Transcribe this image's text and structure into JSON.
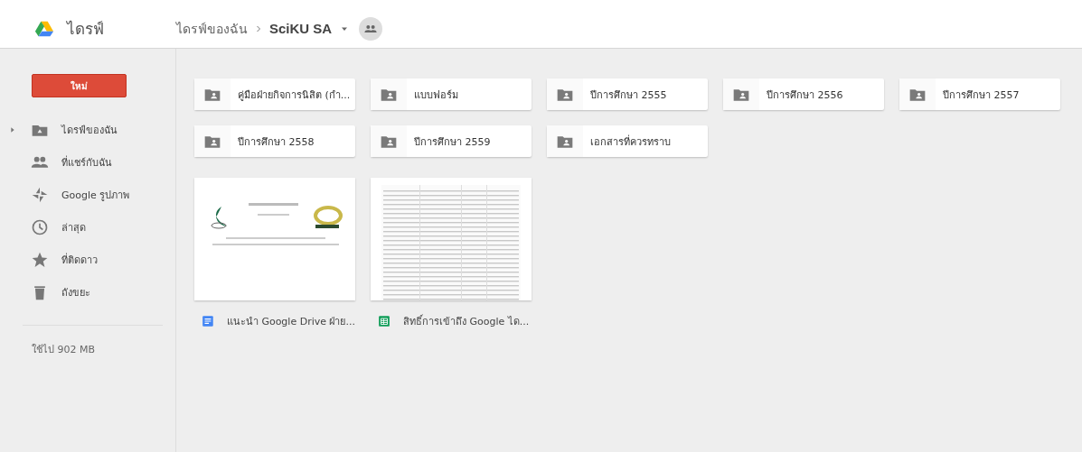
{
  "header": {
    "app_title": "ไดรฟ์",
    "breadcrumb": [
      {
        "label": "ไดรฟ์ของฉัน",
        "current": false
      },
      {
        "label": "SciKU SA",
        "current": true
      }
    ]
  },
  "sidebar": {
    "new_button": "ใหม่",
    "items": [
      {
        "kind": "mydrive",
        "label": "ไดรฟ์ของฉัน",
        "expandable": true
      },
      {
        "kind": "shared",
        "label": "ที่แชร์กับฉัน",
        "expandable": false
      },
      {
        "kind": "photos",
        "label": "Google รูปภาพ",
        "expandable": false
      },
      {
        "kind": "recent",
        "label": "ล่าสุด",
        "expandable": false
      },
      {
        "kind": "starred",
        "label": "ที่ติดดาว",
        "expandable": false
      },
      {
        "kind": "trash",
        "label": "ถังขยะ",
        "expandable": false
      }
    ],
    "storage": "ใช้ไป 902 MB"
  },
  "folders": [
    {
      "name": "คู่มือฝ่ายกิจการนิสิต (กำ..."
    },
    {
      "name": "แบบฟอร์ม"
    },
    {
      "name": "ปีการศึกษา 2555"
    },
    {
      "name": "ปีการศึกษา 2556"
    },
    {
      "name": "ปีการศึกษา 2557"
    },
    {
      "name": "ปีการศึกษา 2558"
    },
    {
      "name": "ปีการศึกษา 2559"
    },
    {
      "name": "เอกสารที่ควรทราบ"
    }
  ],
  "files": [
    {
      "kind": "doc",
      "name": "แนะนำ Google Drive ฝ่าย..."
    },
    {
      "kind": "sheet",
      "name": "สิทธิ์การเข้าถึง Google ได..."
    }
  ]
}
